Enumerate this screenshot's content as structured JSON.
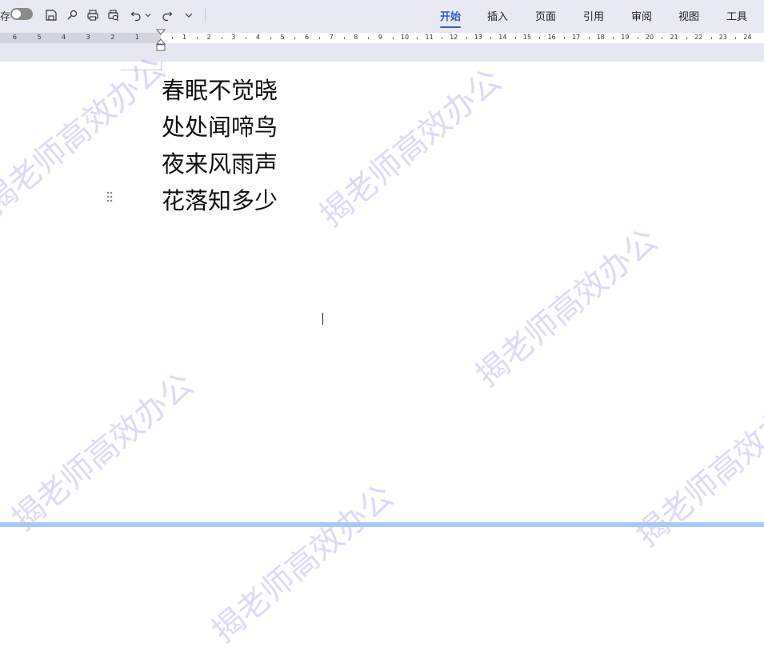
{
  "toolbar": {
    "save_partial_label": "存",
    "tabs": [
      {
        "label": "开始",
        "active": true
      },
      {
        "label": "插入",
        "active": false
      },
      {
        "label": "页面",
        "active": false
      },
      {
        "label": "引用",
        "active": false
      },
      {
        "label": "审阅",
        "active": false
      },
      {
        "label": "视图",
        "active": false
      },
      {
        "label": "工具",
        "active": false
      }
    ]
  },
  "ruler": {
    "left_labels": [
      "6",
      "5",
      "4",
      "3",
      "2",
      "1"
    ],
    "right_labels": [
      "1",
      "2",
      "3",
      "4",
      "5",
      "6",
      "7",
      "8",
      "9",
      "10",
      "11",
      "12",
      "13",
      "14",
      "15",
      "16",
      "17",
      "18",
      "19",
      "20",
      "21",
      "22",
      "23",
      "24"
    ]
  },
  "document": {
    "lines": [
      "春眠不觉晓",
      "处处闻啼鸟",
      "夜来风雨声",
      "花落知多少"
    ]
  },
  "watermark": {
    "text": "揭老师高效办公"
  },
  "colors": {
    "accent": "#2b5fd9",
    "toolbar_bg": "#e8e9f3",
    "watermark": "#787de6",
    "bottom_bar": "#a9c9f4"
  }
}
